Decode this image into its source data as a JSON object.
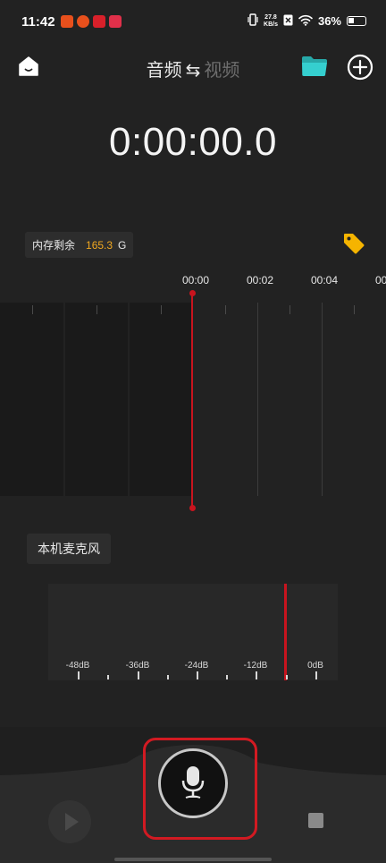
{
  "status": {
    "time": "11:42",
    "net_speed_value": "27.8",
    "net_speed_unit": "KB/s",
    "battery": "36%"
  },
  "header": {
    "mode_audio": "音频",
    "mode_swap": "⇆",
    "mode_video": "视频"
  },
  "timer": "0:00:00.0",
  "storage": {
    "label": "内存剩余",
    "value": "165.3",
    "unit": "G"
  },
  "timeline": {
    "ticks": [
      "00:00",
      "00:02",
      "00:04",
      "00:0"
    ]
  },
  "input_source": "本机麦克风",
  "meter": {
    "labels": [
      "-48dB",
      "-36dB",
      "-24dB",
      "-12dB",
      "0dB"
    ]
  },
  "colors": {
    "accent_red": "#c8141e",
    "storage_value": "#f0a820",
    "folder": "#2ec4c4",
    "tag": "#f5b400"
  },
  "icons": {
    "home": "home-icon",
    "folder": "folder-icon",
    "add": "add-circle-icon",
    "tag": "tag-icon",
    "microphone": "microphone-icon",
    "play": "play-icon",
    "stop": "stop-icon"
  }
}
